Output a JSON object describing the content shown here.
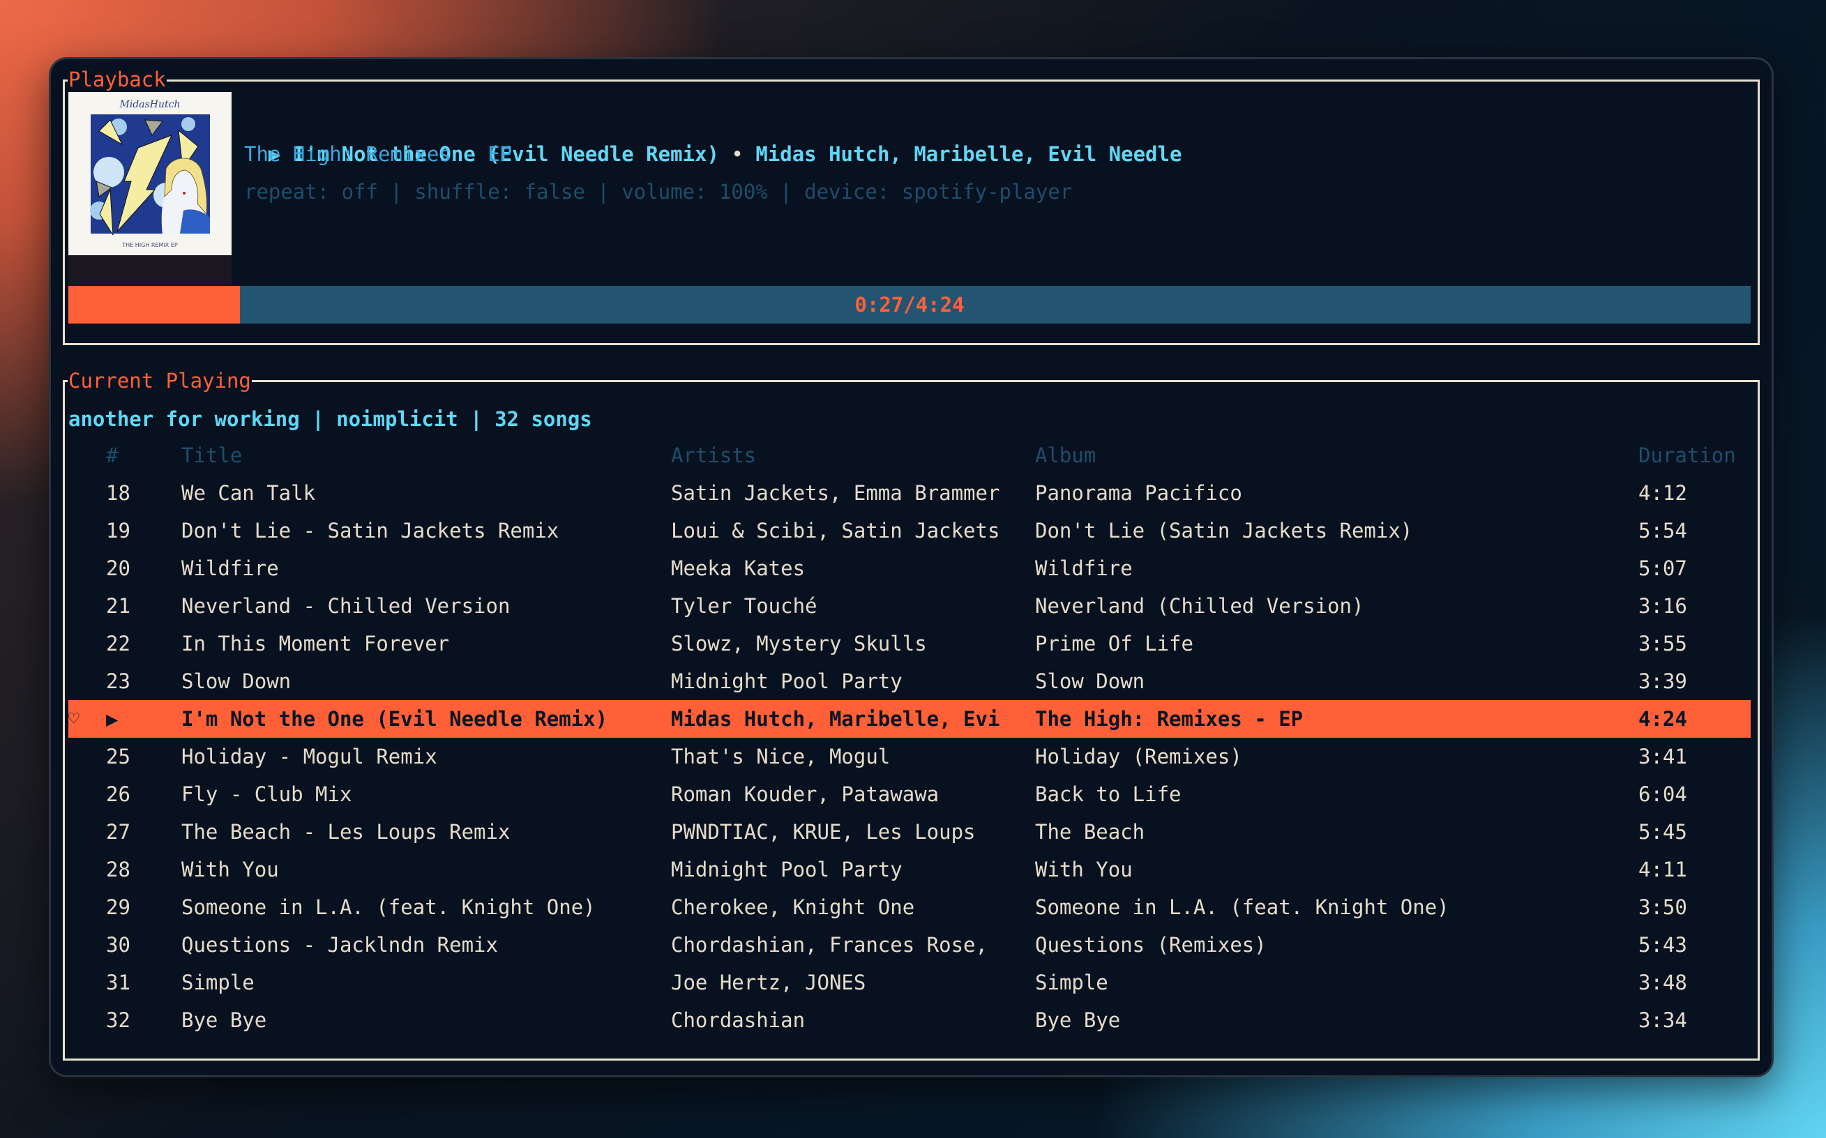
{
  "playback": {
    "section_title": "Playback",
    "track_line": "▶ I'm Not the One (Evil Needle Remix)",
    "separator": "•",
    "artists": "Midas Hutch, Maribelle, Evil Needle",
    "album": "The High: Remixes - EP",
    "status_line": "repeat: off | shuffle: false | volume: 100% | device: spotify-player",
    "album_art": {
      "artist_script": "MidasHutch",
      "caption": "THE HIGH REMIX EP"
    },
    "progress": {
      "elapsed": "0:27",
      "total": "4:24",
      "label": "0:27/4:24",
      "fraction": 0.102
    }
  },
  "current_playing": {
    "section_title": "Current Playing",
    "summary": "another for working | noimplicit | 32 songs",
    "columns": {
      "num": "#",
      "title": "Title",
      "artists": "Artists",
      "album": "Album",
      "duration": "Duration"
    },
    "rows": [
      {
        "num": "18",
        "title": "We Can Talk",
        "artists": "Satin Jackets, Emma Brammer",
        "album": "Panorama Pacifico",
        "duration": "4:12"
      },
      {
        "num": "19",
        "title": "Don't Lie - Satin Jackets Remix",
        "artists": "Loui & Scibi, Satin Jackets",
        "album": "Don't Lie (Satin Jackets Remix)",
        "duration": "5:54"
      },
      {
        "num": "20",
        "title": "Wildfire",
        "artists": "Meeka Kates",
        "album": "Wildfire",
        "duration": "5:07"
      },
      {
        "num": "21",
        "title": "Neverland - Chilled Version",
        "artists": "Tyler Touché",
        "album": "Neverland (Chilled Version)",
        "duration": "3:16"
      },
      {
        "num": "22",
        "title": "In This Moment Forever",
        "artists": "Slowz, Mystery Skulls",
        "album": "Prime Of Life",
        "duration": "3:55"
      },
      {
        "num": "23",
        "title": "Slow Down",
        "artists": "Midnight Pool Party",
        "album": "Slow Down",
        "duration": "3:39"
      },
      {
        "num": "▶",
        "title": "I'm Not the One (Evil Needle Remix)",
        "artists": "Midas Hutch, Maribelle, Evi",
        "album": "The High: Remixes - EP",
        "duration": "4:24",
        "active": true,
        "liked_icon": "♡"
      },
      {
        "num": "25",
        "title": "Holiday - Mogul Remix",
        "artists": "That's Nice, Mogul",
        "album": "Holiday (Remixes)",
        "duration": "3:41"
      },
      {
        "num": "26",
        "title": "Fly - Club Mix",
        "artists": "Roman Kouder, Patawawa",
        "album": "Back to Life",
        "duration": "6:04"
      },
      {
        "num": "27",
        "title": "The Beach - Les Loups Remix",
        "artists": "PWNDTIAC, KRUE, Les Loups",
        "album": "The Beach",
        "duration": "5:45"
      },
      {
        "num": "28",
        "title": "With You",
        "artists": "Midnight Pool Party",
        "album": "With You",
        "duration": "4:11"
      },
      {
        "num": "29",
        "title": "Someone in L.A. (feat. Knight One)",
        "artists": "Cherokee, Knight One",
        "album": "Someone in L.A. (feat. Knight One)",
        "duration": "3:50"
      },
      {
        "num": "30",
        "title": "Questions - Jacklndn Remix",
        "artists": "Chordashian, Frances Rose,",
        "album": "Questions (Remixes)",
        "duration": "5:43"
      },
      {
        "num": "31",
        "title": "Simple",
        "artists": "Joe Hertz, JONES",
        "album": "Simple",
        "duration": "3:48"
      },
      {
        "num": "32",
        "title": "Bye Bye",
        "artists": "Chordashian",
        "album": "Bye Bye",
        "duration": "3:34"
      }
    ]
  },
  "colors": {
    "accent": "#ff6038",
    "title_text": "#5fd7f5",
    "album_text": "#3aa8e0",
    "dim_text": "#1f4d6b",
    "row_text": "#e6dccb",
    "progress_track": "#235573",
    "border": "#e8e2d0",
    "window_bg": "#07111f"
  }
}
